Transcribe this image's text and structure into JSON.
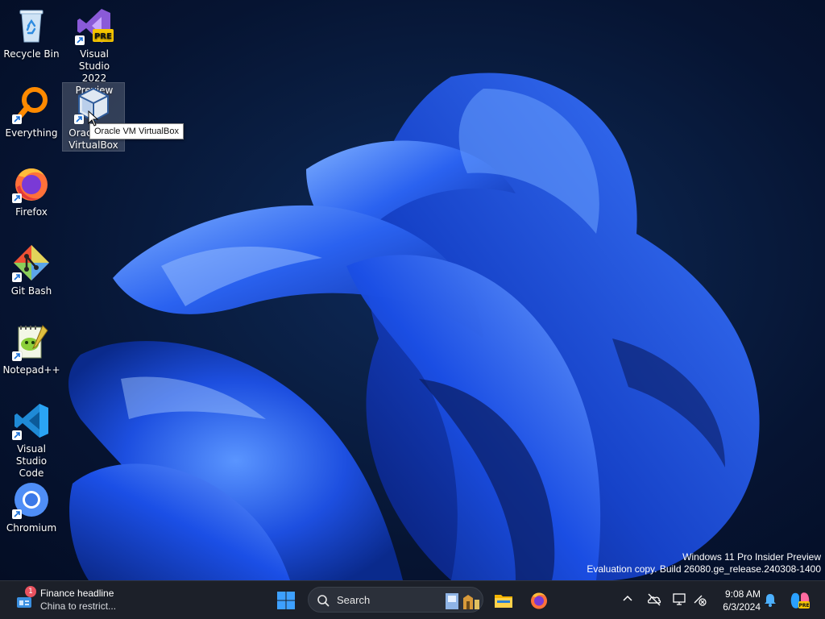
{
  "desktop": {
    "icons": [
      {
        "id": "recycle-bin",
        "label": "Recycle Bin"
      },
      {
        "id": "visual-studio",
        "label_line1": "Visual Studio",
        "label_line2": "2022 Preview",
        "badge": "PRE"
      },
      {
        "id": "everything",
        "label": "Everything"
      },
      {
        "id": "virtualbox",
        "label_line1": "Oracle VM",
        "label_line2": "VirtualBox"
      },
      {
        "id": "firefox",
        "label": "Firefox"
      },
      {
        "id": "git-bash",
        "label": "Git Bash"
      },
      {
        "id": "notepadpp",
        "label": "Notepad++"
      },
      {
        "id": "vscode",
        "label_line1": "Visual Studio",
        "label_line2": "Code"
      },
      {
        "id": "chromium",
        "label": "Chromium"
      }
    ],
    "tooltip": "Oracle VM VirtualBox",
    "watermark": {
      "line1": "Windows 11 Pro Insider Preview",
      "line2": "Evaluation copy. Build 26080.ge_release.240308-1400"
    }
  },
  "taskbar": {
    "widget": {
      "badge": "1",
      "headline": "Finance headline",
      "subtext": "China to restrict..."
    },
    "search": {
      "label": "Search"
    },
    "pinned": [
      "start-icon",
      "file-explorer-icon",
      "firefox-icon"
    ],
    "tray_icons": [
      "chevron-up-icon",
      "onedrive-icon",
      "display-icon",
      "network-icon",
      "notification-bell-icon",
      "copilot-icon"
    ],
    "clock": {
      "time": "9:08 AM",
      "date": "6/3/2024"
    }
  },
  "colors": {
    "taskbar_bg": "#1c2029",
    "accent_blue": "#1d5cff",
    "wallpaper_dark": "#061432"
  }
}
